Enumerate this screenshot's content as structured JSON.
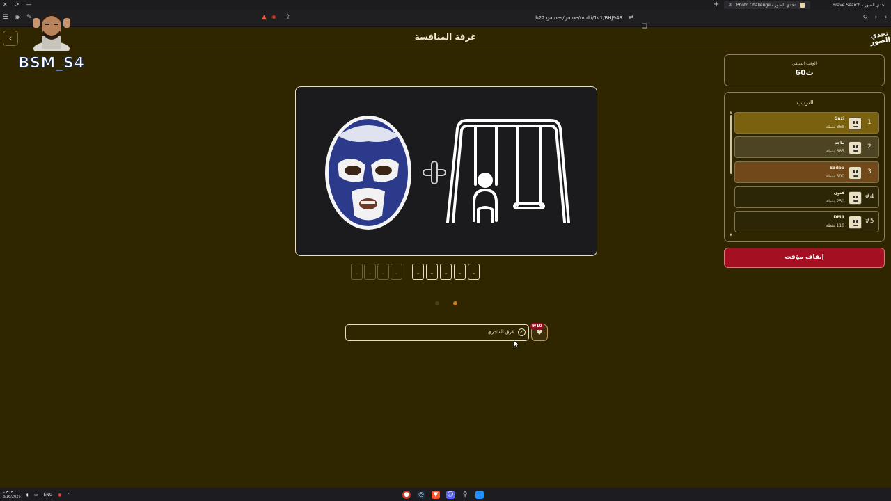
{
  "browser": {
    "active_tab_title": "Photo Challenge - تحدي الصور",
    "other_tab_title": "Brave Search - تحدي الصور",
    "url": "b22.games/game/multi/1v1/BHJ943"
  },
  "overlay": {
    "streamer_tag": "BSM_S4"
  },
  "header": {
    "title": "غرفة المنافسة",
    "logo_text": "تحدي الصور"
  },
  "timer": {
    "label": "الوقت المتبقي",
    "value": "60ث"
  },
  "leaderboard": {
    "title": "الترتيب",
    "players": [
      {
        "rank": "1",
        "name": "Gazi",
        "points": "868 نقطة",
        "bg": "#7a6110"
      },
      {
        "rank": "2",
        "name": "ماجد",
        "points": "685 نقطة",
        "bg": "#4d4424"
      },
      {
        "rank": "3",
        "name": "S3doo",
        "points": "300 نقطة",
        "bg": "#70481a"
      },
      {
        "rank": "#4",
        "name": "فنون",
        "points": "250 نقطة",
        "bg": "#2c2506"
      },
      {
        "rank": "#5",
        "name": "DMR",
        "points": "110 نقطة",
        "bg": "#2c2506"
      }
    ]
  },
  "stop_button": {
    "label": "إيقاف مؤقت"
  },
  "answer": {
    "word1_slots": [
      "-",
      "-",
      "-",
      "-"
    ],
    "word2_slots": [
      "-",
      "-",
      "-",
      "-",
      "-"
    ],
    "input_value": "غرق العاجزي",
    "hint_badge": "9/10"
  },
  "taskbar": {
    "lang": "ENG",
    "date": "3/16/2026",
    "time": "٣:١٣ م"
  },
  "colors": {
    "background": "#2f2600",
    "accent_red": "#a50f22",
    "gold": "#7a6110"
  }
}
